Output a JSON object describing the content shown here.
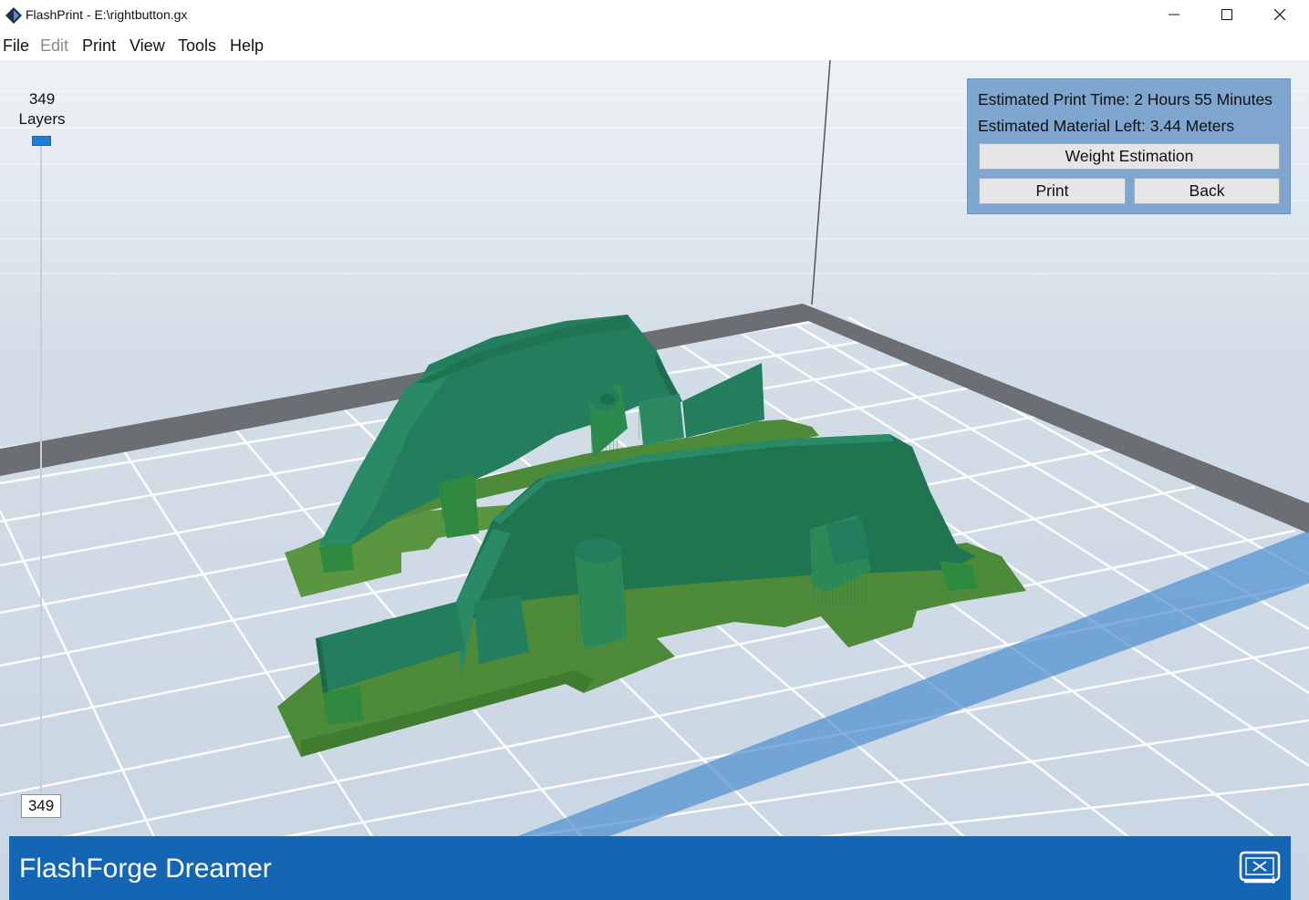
{
  "window": {
    "title": "FlashPrint - E:\\rightbutton.gx",
    "minimize_icon": "minimize-icon",
    "maximize_icon": "maximize-icon",
    "close_icon": "close-icon"
  },
  "menu": {
    "items": [
      {
        "label": "File",
        "enabled": true
      },
      {
        "label": "Edit",
        "enabled": false
      },
      {
        "label": "Print",
        "enabled": true
      },
      {
        "label": "View",
        "enabled": true
      },
      {
        "label": "Tools",
        "enabled": true
      },
      {
        "label": "Help",
        "enabled": true
      }
    ]
  },
  "layers": {
    "count": "349",
    "label": "Layers",
    "current": "349",
    "slider_fraction": 1.0
  },
  "info": {
    "print_time_label": "Estimated Print Time:",
    "print_time_value": "2 Hours 55 Minutes",
    "material_label": "Estimated Material Left:",
    "material_value": "3.44 Meters",
    "weight_button": "Weight Estimation",
    "print_button": "Print",
    "back_button": "Back"
  },
  "status": {
    "printer_name": "FlashForge Dreamer",
    "printer_icon": "printer-connect-icon"
  },
  "colors": {
    "status_bar": "#1565b5",
    "info_panel": "#7fa6cf",
    "model_green": "#237e5d",
    "raft_green": "#4d8a3a",
    "slider_handle": "#1a7fd6",
    "grid_bg": "#d3dde7"
  }
}
